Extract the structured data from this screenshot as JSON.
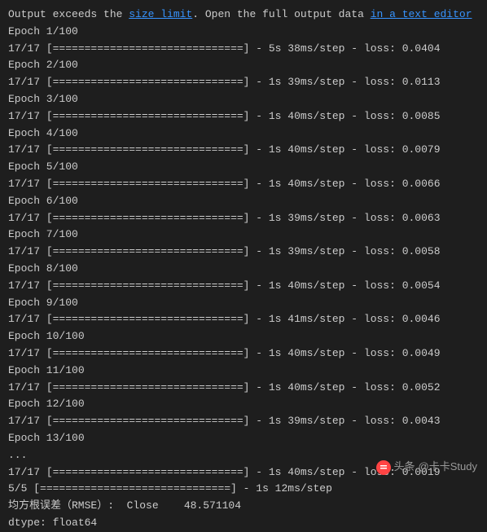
{
  "header": {
    "prefix": "Output exceeds the ",
    "link1": "size limit",
    "middle": ". Open the full output data ",
    "link2": "in a text editor"
  },
  "progress_bar": "[==============================]",
  "epochs": [
    {
      "label": "Epoch 1/100",
      "steps": "17/17",
      "stats": " - 5s 38ms/step - loss: 0.0404"
    },
    {
      "label": "Epoch 2/100",
      "steps": "17/17",
      "stats": " - 1s 39ms/step - loss: 0.0113"
    },
    {
      "label": "Epoch 3/100",
      "steps": "17/17",
      "stats": " - 1s 40ms/step - loss: 0.0085"
    },
    {
      "label": "Epoch 4/100",
      "steps": "17/17",
      "stats": " - 1s 40ms/step - loss: 0.0079"
    },
    {
      "label": "Epoch 5/100",
      "steps": "17/17",
      "stats": " - 1s 40ms/step - loss: 0.0066"
    },
    {
      "label": "Epoch 6/100",
      "steps": "17/17",
      "stats": " - 1s 39ms/step - loss: 0.0063"
    },
    {
      "label": "Epoch 7/100",
      "steps": "17/17",
      "stats": " - 1s 39ms/step - loss: 0.0058"
    },
    {
      "label": "Epoch 8/100",
      "steps": "17/17",
      "stats": " - 1s 40ms/step - loss: 0.0054"
    },
    {
      "label": "Epoch 9/100",
      "steps": "17/17",
      "stats": " - 1s 41ms/step - loss: 0.0046"
    },
    {
      "label": "Epoch 10/100",
      "steps": "17/17",
      "stats": " - 1s 40ms/step - loss: 0.0049"
    },
    {
      "label": "Epoch 11/100",
      "steps": "17/17",
      "stats": " - 1s 40ms/step - loss: 0.0052"
    },
    {
      "label": "Epoch 12/100",
      "steps": "17/17",
      "stats": " - 1s 39ms/step - loss: 0.0043"
    },
    {
      "label": "Epoch 13/100",
      "steps": null,
      "stats": null
    }
  ],
  "ellipsis": "...",
  "final_epoch": {
    "steps": "17/17",
    "stats": " - 1s 40ms/step - loss: 0.0019"
  },
  "eval": {
    "steps": "5/5",
    "stats": " - 1s 12ms/step"
  },
  "rmse": "均方根误差（RMSE）:  Close    48.571104",
  "dtype": "dtype: float64",
  "watermark": {
    "prefix": "头条",
    "suffix": "@卡卡Study"
  }
}
